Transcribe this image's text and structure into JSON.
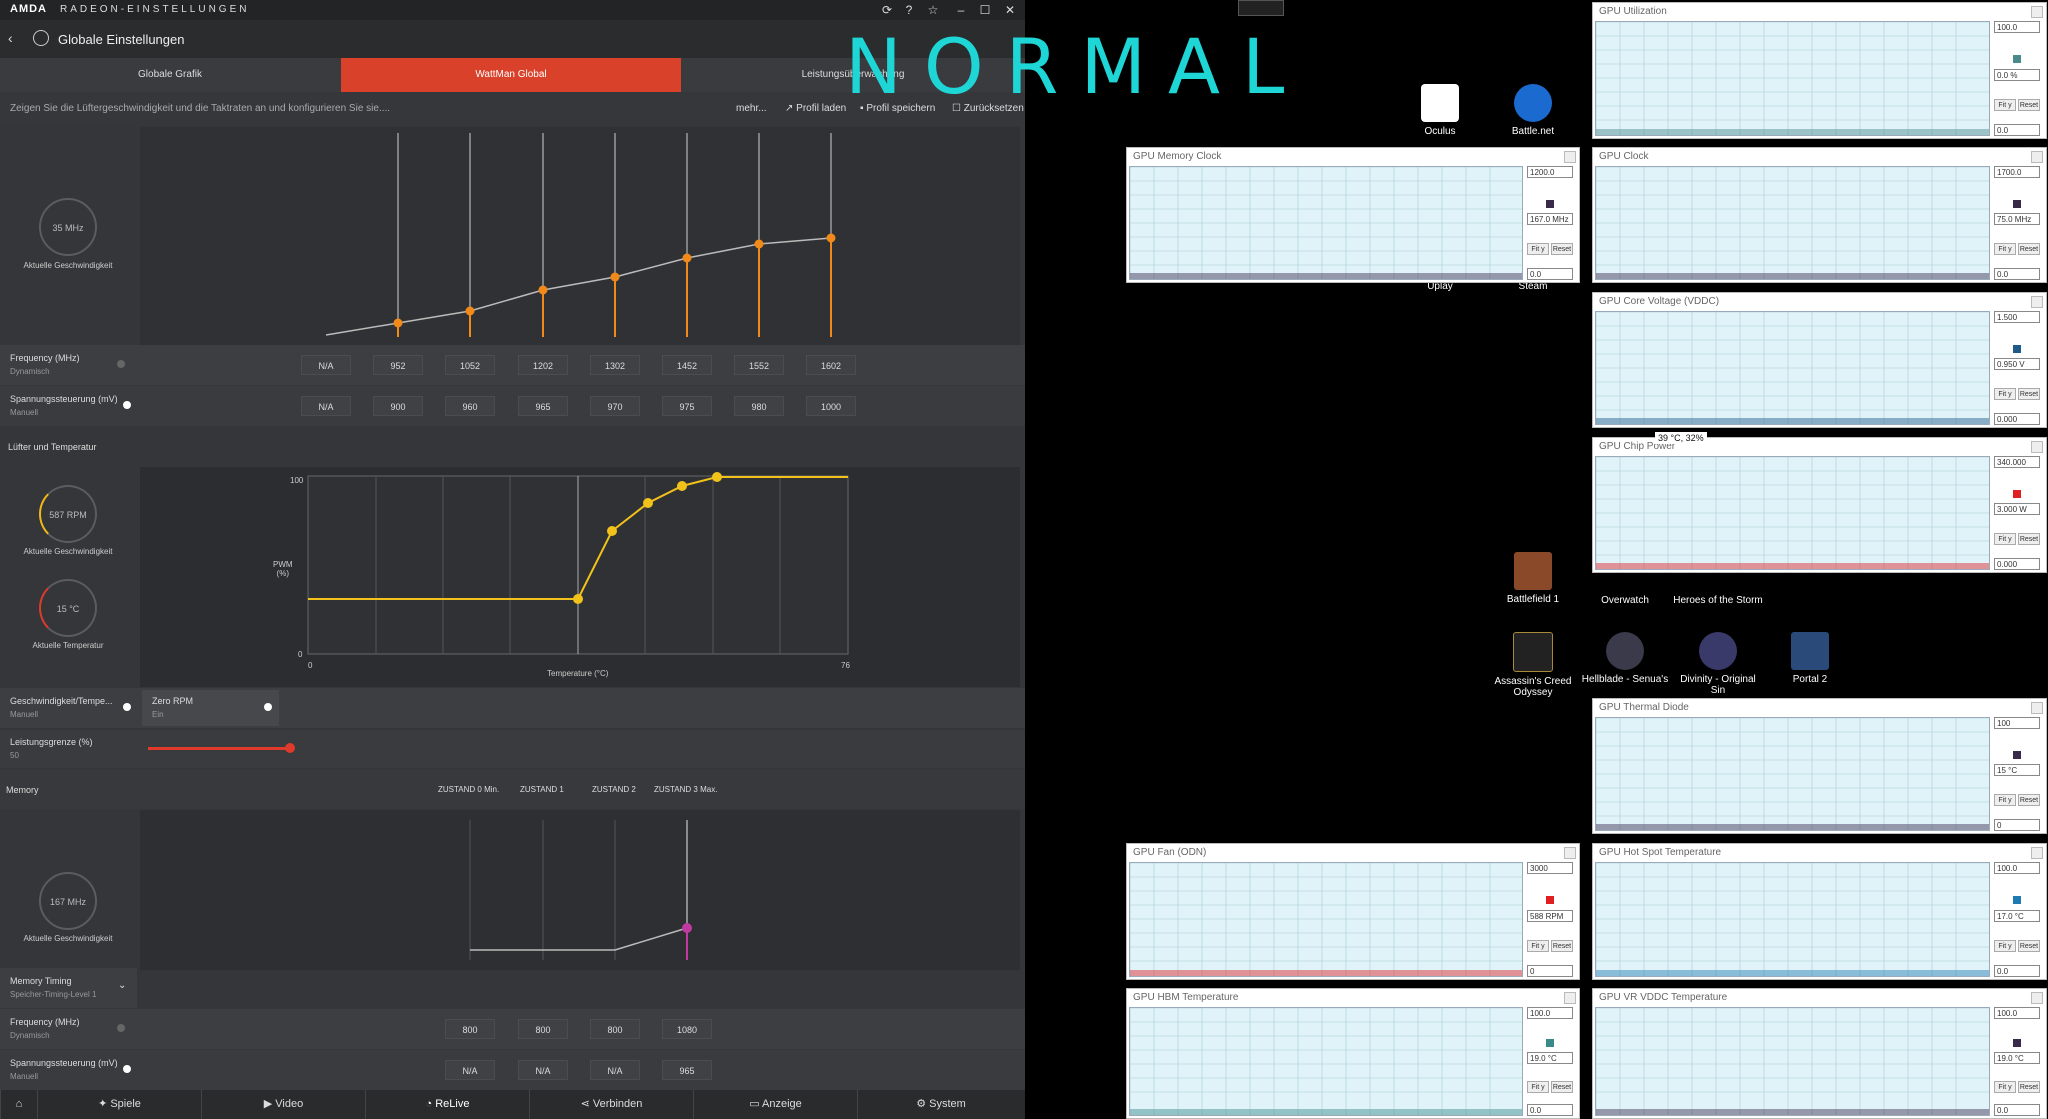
{
  "overlay_title": "NORMAL",
  "radeon": {
    "brand": "AMDA",
    "brand_sub": "RADEON-EINSTELLUNGEN",
    "page_title": "Globale Einstellungen",
    "tabs": [
      "Globale Grafik",
      "WattMan Global",
      "Leistungsüberwachung"
    ],
    "description": "Zeigen Sie die Lüftergeschwindigkeit und die Taktraten an und konfigurieren Sie sie....",
    "toolbar": {
      "more": "mehr...",
      "load": "Profil laden",
      "save": "Profil speichern",
      "reset": "Zurücksetzen"
    },
    "gpu_gauge": {
      "value": "35 MHz",
      "label": "Aktuelle Geschwindigkeit"
    },
    "gpu_freq_row": {
      "label": "Frequency (MHz)",
      "sub": "Dynamisch",
      "values": [
        "N/A",
        "952",
        "1052",
        "1202",
        "1302",
        "1452",
        "1552",
        "1602"
      ]
    },
    "gpu_volt_row": {
      "label": "Spannungssteuerung (mV)",
      "sub": "Manuell",
      "values": [
        "N/A",
        "900",
        "960",
        "965",
        "970",
        "975",
        "980",
        "1000"
      ]
    },
    "fan_section": "Lüfter und Temperatur",
    "fan_gauge": {
      "value": "587 RPM",
      "label": "Aktuelle Geschwindigkeit"
    },
    "temp_gauge": {
      "value": "15 °C",
      "label": "Aktuelle Temperatur"
    },
    "fan_chart": {
      "ylabel": "PWM\n(%)",
      "ytop": "100",
      "ybottom": "0",
      "xleft": "0",
      "xright": "76",
      "xlabel": "Temperature (°C)"
    },
    "speed_temp_row": {
      "label": "Geschwindigkeit/Tempe...",
      "sub": "Manuell"
    },
    "zero_rpm": {
      "label": "Zero RPM",
      "sub": "Ein"
    },
    "power_limit": {
      "label": "Leistungsgrenze (%)",
      "sub": "50",
      "level": 0.5
    },
    "memory_section": "Memory",
    "mem_states": [
      "ZUSTAND 0 Min.",
      "ZUSTAND 1",
      "ZUSTAND 2",
      "ZUSTAND 3 Max."
    ],
    "mem_gauge": {
      "value": "167 MHz",
      "label": "Aktuelle Geschwindigkeit"
    },
    "mem_timing": {
      "label": "Memory Timing",
      "sub": "Speicher-Timing-Level 1"
    },
    "mem_freq_row": {
      "label": "Frequency (MHz)",
      "sub": "Dynamisch",
      "values": [
        "800",
        "800",
        "800",
        "1080"
      ]
    },
    "mem_volt_row": {
      "label": "Spannungssteuerung (mV)",
      "sub": "Manuell",
      "values": [
        "N/A",
        "N/A",
        "N/A",
        "965"
      ]
    },
    "bottom_tabs": [
      "Spiele",
      "Video",
      "ReLive",
      "Verbinden",
      "Anzeige",
      "System"
    ]
  },
  "desktop_icons": [
    "Oculus",
    "Battle.net",
    "Uplay",
    "Steam",
    "Battlefield 1",
    "Overwatch",
    "Heroes of the Storm",
    "Assassin's Creed Odyssey",
    "Hellblade - Senua's",
    "Divinity - Original Sin",
    "Portal 2"
  ],
  "tooltip": "39 °C, 32%",
  "monitors": [
    {
      "title": "GPU Utilization",
      "max": "100.0",
      "cur": "0.0 %",
      "min": "0.0",
      "color": "#4a8a8a"
    },
    {
      "title": "GPU Memory Clock",
      "max": "1200.0",
      "cur": "167.0 MHz",
      "min": "0.0",
      "color": "#3a2a4a"
    },
    {
      "title": "GPU Clock",
      "max": "1700.0",
      "cur": "75.0 MHz",
      "min": "0.0",
      "color": "#3a2a4a"
    },
    {
      "title": "GPU Core Voltage (VDDC)",
      "max": "1.500",
      "cur": "0.950 V",
      "min": "0.000",
      "color": "#1e5a8a"
    },
    {
      "title": "GPU Chip Power",
      "max": "340.000",
      "cur": "3.000 W",
      "min": "0.000",
      "color": "#e02020"
    },
    {
      "title": "GPU Thermal Diode",
      "max": "100",
      "cur": "15 °C",
      "min": "0",
      "color": "#3a2a4a"
    },
    {
      "title": "GPU Fan (ODN)",
      "max": "3000",
      "cur": "588 RPM",
      "min": "0",
      "color": "#e02020"
    },
    {
      "title": "GPU Hot Spot Temperature",
      "max": "100.0",
      "cur": "17.0 °C",
      "min": "0.0",
      "color": "#1e7ab0"
    },
    {
      "title": "GPU HBM Temperature",
      "max": "100.0",
      "cur": "19.0 °C",
      "min": "0.0",
      "color": "#3a8a8a"
    },
    {
      "title": "GPU VR VDDC Temperature",
      "max": "100.0",
      "cur": "19.0 °C",
      "min": "0.0",
      "color": "#3a2a4a"
    }
  ],
  "monitor_buttons": {
    "fit": "Fit y",
    "reset": "Reset"
  }
}
